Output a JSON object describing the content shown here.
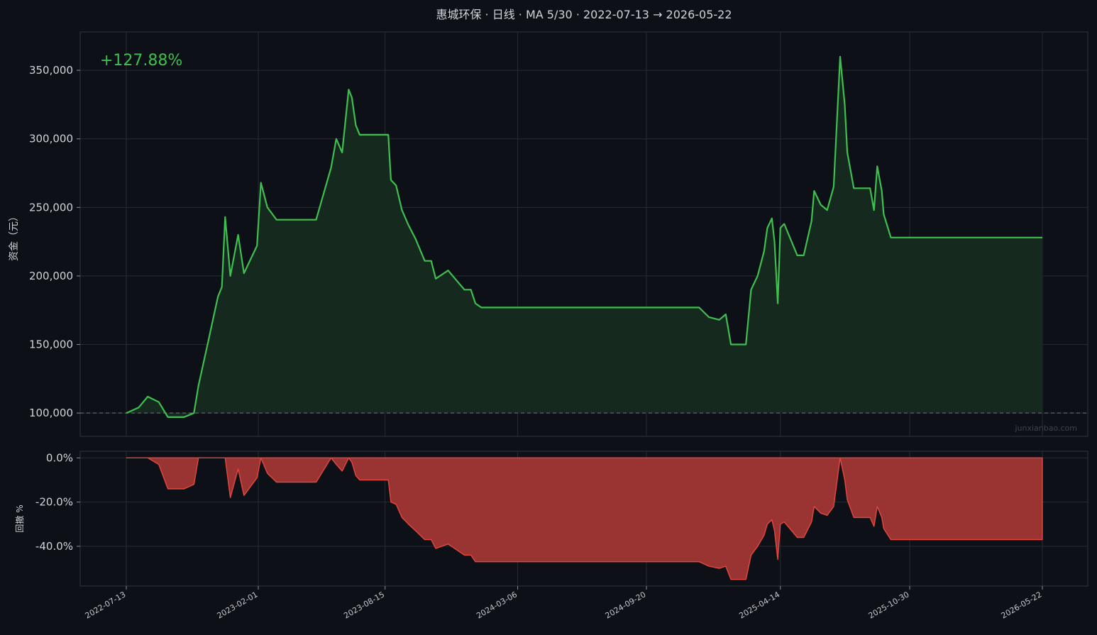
{
  "title": "惠城环保 · 日线 · MA 5/30 · 2022-07-13 → 2026-05-22",
  "return_label": "+127.88%",
  "watermark": "junxianbao.com",
  "colors": {
    "background": "#0d1017",
    "panel": "#0d1017",
    "grid": "#262b33",
    "equity_line": "#3fbf4f",
    "equity_fill": "#16291f",
    "drawdown_line": "#e5473f",
    "drawdown_fill": "#9a3432",
    "baseline": "#6f747c",
    "text": "#d0d3d8"
  },
  "chart_data": [
    {
      "type": "area",
      "panel": "equity",
      "ylabel": "资金（元）",
      "yticks": [
        100000,
        150000,
        200000,
        250000,
        300000,
        350000
      ],
      "ytick_labels": [
        "100,000",
        "150,000",
        "200,000",
        "250,000",
        "300,000",
        "350,000"
      ],
      "ylim": [
        83000,
        378000
      ],
      "baseline": 100000,
      "x_dates": [
        "2022-07-13",
        "2022-08-01",
        "2022-08-15",
        "2022-09-01",
        "2022-09-15",
        "2022-10-10",
        "2022-10-25",
        "2022-11-01",
        "2022-11-15",
        "2022-12-01",
        "2022-12-07",
        "2022-12-12",
        "2022-12-20",
        "2023-01-01",
        "2023-01-10",
        "2023-01-30",
        "2023-02-05",
        "2023-02-15",
        "2023-03-01",
        "2023-03-15",
        "2023-04-01",
        "2023-05-01",
        "2023-05-24",
        "2023-06-01",
        "2023-06-10",
        "2023-06-20",
        "2023-06-25",
        "2023-07-01",
        "2023-07-07",
        "2023-07-14",
        "2023-07-20",
        "2023-08-01",
        "2023-08-20",
        "2023-08-24",
        "2023-09-01",
        "2023-09-10",
        "2023-09-20",
        "2023-10-01",
        "2023-10-15",
        "2023-10-25",
        "2023-11-01",
        "2023-11-20",
        "2023-12-15",
        "2023-12-25",
        "2024-01-01",
        "2024-01-10",
        "2024-01-20",
        "2024-02-01",
        "2024-12-01",
        "2024-12-10",
        "2024-12-25",
        "2025-01-10",
        "2025-01-20",
        "2025-01-28",
        "2025-02-20",
        "2025-02-28",
        "2025-03-10",
        "2025-03-20",
        "2025-03-25",
        "2025-04-01",
        "2025-04-05",
        "2025-04-10",
        "2025-04-14",
        "2025-04-20",
        "2025-05-10",
        "2025-05-20",
        "2025-06-01",
        "2025-06-05",
        "2025-06-15",
        "2025-06-25",
        "2025-07-05",
        "2025-07-15",
        "2025-07-22",
        "2025-07-26",
        "2025-08-05",
        "2025-08-15",
        "2025-08-30",
        "2025-09-05",
        "2025-09-10",
        "2025-09-17",
        "2025-09-20",
        "2025-10-01",
        "2026-05-22"
      ],
      "values": [
        100000,
        104000,
        112000,
        108000,
        97000,
        97000,
        100000,
        120000,
        150000,
        185000,
        192000,
        243000,
        200000,
        230000,
        202000,
        222000,
        268000,
        250000,
        241000,
        241000,
        241000,
        241000,
        279000,
        300000,
        290000,
        336000,
        330000,
        310000,
        303000,
        303000,
        303000,
        303000,
        303000,
        270000,
        266000,
        248000,
        237000,
        227000,
        211000,
        211000,
        198000,
        204000,
        190000,
        190000,
        180000,
        177000,
        177000,
        177000,
        177000,
        177000,
        170000,
        168000,
        172000,
        150000,
        150000,
        190000,
        200000,
        218000,
        235000,
        242000,
        225000,
        180000,
        235000,
        238000,
        215000,
        215000,
        240000,
        262000,
        252000,
        248000,
        265000,
        360000,
        325000,
        290000,
        264000,
        264000,
        264000,
        248000,
        280000,
        262000,
        245000,
        228000,
        228000
      ],
      "series": [
        {
          "name": "equity",
          "values_ref": "values"
        }
      ]
    },
    {
      "type": "area",
      "panel": "drawdown",
      "ylabel": "回撤 %",
      "yticks": [
        0,
        -20,
        -40
      ],
      "ytick_labels": [
        "0.0%",
        "-20.0%",
        "-40.0%"
      ],
      "ylim": [
        -58,
        3
      ],
      "xticks": [
        "2022-07-13",
        "2023-02-01",
        "2023-08-15",
        "2024-03-06",
        "2024-09-20",
        "2025-04-14",
        "2025-10-30",
        "2026-05-22"
      ],
      "x_dates": [
        "2022-07-13",
        "2022-08-01",
        "2022-08-15",
        "2022-09-01",
        "2022-09-15",
        "2022-10-10",
        "2022-10-25",
        "2022-11-01",
        "2022-11-15",
        "2022-12-01",
        "2022-12-07",
        "2022-12-12",
        "2022-12-20",
        "2023-01-01",
        "2023-01-10",
        "2023-01-30",
        "2023-02-05",
        "2023-02-15",
        "2023-03-01",
        "2023-03-15",
        "2023-04-01",
        "2023-05-01",
        "2023-05-24",
        "2023-06-01",
        "2023-06-10",
        "2023-06-20",
        "2023-06-25",
        "2023-07-01",
        "2023-07-07",
        "2023-07-14",
        "2023-07-20",
        "2023-08-01",
        "2023-08-20",
        "2023-08-24",
        "2023-09-01",
        "2023-09-10",
        "2023-09-20",
        "2023-10-01",
        "2023-10-15",
        "2023-10-25",
        "2023-11-01",
        "2023-11-20",
        "2023-12-15",
        "2023-12-25",
        "2024-01-01",
        "2024-01-10",
        "2024-01-20",
        "2024-02-01",
        "2024-12-01",
        "2024-12-10",
        "2024-12-25",
        "2025-01-10",
        "2025-01-20",
        "2025-01-28",
        "2025-02-20",
        "2025-02-28",
        "2025-03-10",
        "2025-03-20",
        "2025-03-25",
        "2025-04-01",
        "2025-04-05",
        "2025-04-10",
        "2025-04-14",
        "2025-04-20",
        "2025-05-10",
        "2025-05-20",
        "2025-06-01",
        "2025-06-05",
        "2025-06-15",
        "2025-06-25",
        "2025-07-05",
        "2025-07-15",
        "2025-07-22",
        "2025-07-26",
        "2025-08-05",
        "2025-08-15",
        "2025-08-30",
        "2025-09-05",
        "2025-09-10",
        "2025-09-17",
        "2025-09-20",
        "2025-10-01",
        "2026-05-22"
      ],
      "values": [
        0,
        0,
        0,
        -3,
        -14,
        -14,
        -12,
        0,
        0,
        0,
        0,
        0,
        -18,
        -5,
        -17,
        -9,
        0,
        -7,
        -11,
        -11,
        -11,
        -11,
        0,
        -3,
        -6,
        0,
        -2,
        -8,
        -10,
        -10,
        -10,
        -10,
        -10,
        -20,
        -21,
        -27,
        -30,
        -33,
        -37,
        -37,
        -41,
        -39,
        -44,
        -44,
        -47,
        -47,
        -47,
        -47,
        -47,
        -47,
        -49,
        -50,
        -49,
        -55,
        -55,
        -44,
        -40,
        -35,
        -30,
        -28,
        -33,
        -46,
        -30,
        -29,
        -36,
        -36,
        -29,
        -22,
        -25,
        -26,
        -22,
        0,
        -10,
        -19,
        -27,
        -27,
        -27,
        -31,
        -22,
        -27,
        -32,
        -37,
        -37
      ],
      "series": [
        {
          "name": "drawdown",
          "values_ref": "values"
        }
      ]
    }
  ]
}
